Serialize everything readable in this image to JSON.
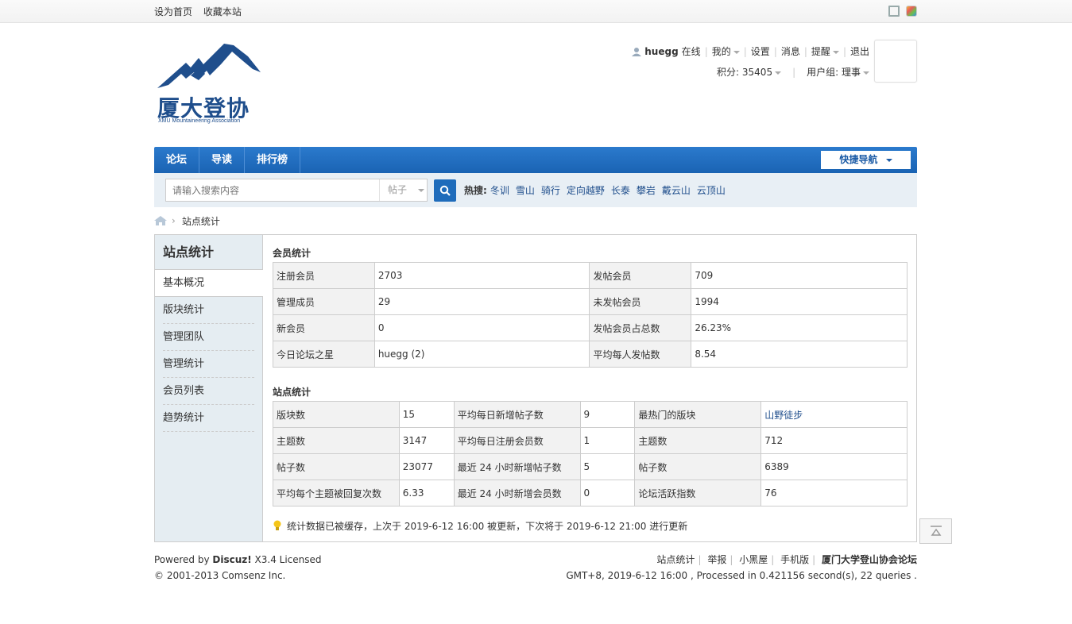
{
  "topbar": {
    "set_home": "设为首页",
    "bookmark": "收藏本站"
  },
  "logo": {
    "title": "厦大登协",
    "subtitle": "XMU Mountaineering Association"
  },
  "user": {
    "name": "huegg",
    "online": "在线",
    "mine": "我的",
    "settings": "设置",
    "messages": "消息",
    "reminders": "提醒",
    "logout": "退出",
    "points": "积分: 35405",
    "group": "用户组: 理事"
  },
  "nav": {
    "items": [
      "论坛",
      "导读",
      "排行榜"
    ],
    "quick": "快捷导航"
  },
  "search": {
    "placeholder": "请输入搜索内容",
    "type": "帖子",
    "hot_label": "热搜:",
    "hot": [
      "冬训",
      "雪山",
      "骑行",
      "定向越野",
      "长泰",
      "攀岩",
      "戴云山",
      "云顶山"
    ]
  },
  "breadcrumb": {
    "current": "站点统计"
  },
  "sidebar": {
    "title": "站点统计",
    "items": [
      "基本概况",
      "版块统计",
      "管理团队",
      "管理统计",
      "会员列表",
      "趋势统计"
    ]
  },
  "member_stats": {
    "title": "会员统计",
    "rows": [
      [
        "注册会员",
        "2703",
        "发帖会员",
        "709"
      ],
      [
        "管理成员",
        "29",
        "未发帖会员",
        "1994"
      ],
      [
        "新会员",
        "0",
        "发帖会员占总数",
        "26.23%"
      ],
      [
        "今日论坛之星",
        "huegg (2)",
        "平均每人发帖数",
        "8.54"
      ]
    ]
  },
  "site_stats": {
    "title": "站点统计",
    "rows": [
      [
        "版块数",
        "15",
        "平均每日新增帖子数",
        "9",
        "最热门的版块",
        "山野徒步"
      ],
      [
        "主题数",
        "3147",
        "平均每日注册会员数",
        "1",
        "主题数",
        "712"
      ],
      [
        "帖子数",
        "23077",
        "最近 24 小时新增帖子数",
        "5",
        "帖子数",
        "6389"
      ],
      [
        "平均每个主题被回复次数",
        "6.33",
        "最近 24 小时新增会员数",
        "0",
        "论坛活跃指数",
        "76"
      ]
    ]
  },
  "notice": "统计数据已被缓存，上次于 2019-6-12 16:00 被更新，下次将于 2019-6-12 21:00 进行更新",
  "footer": {
    "powered_prefix": "Powered by ",
    "powered_brand": "Discuz!",
    "powered_suffix": " X3.4 Licensed",
    "copyright": "© 2001-2013 Comsenz Inc.",
    "links": [
      "站点统计",
      "举报",
      "小黑屋",
      "手机版"
    ],
    "site_name": "厦门大学登山协会论坛",
    "processed": "GMT+8, 2019-6-12 16:00 , Processed in 0.421156 second(s), 22 queries ."
  },
  "colors": {
    "nav_blue": "#1a63b3",
    "link_blue": "#1f4e8c",
    "side_bg": "#e5edf2"
  }
}
